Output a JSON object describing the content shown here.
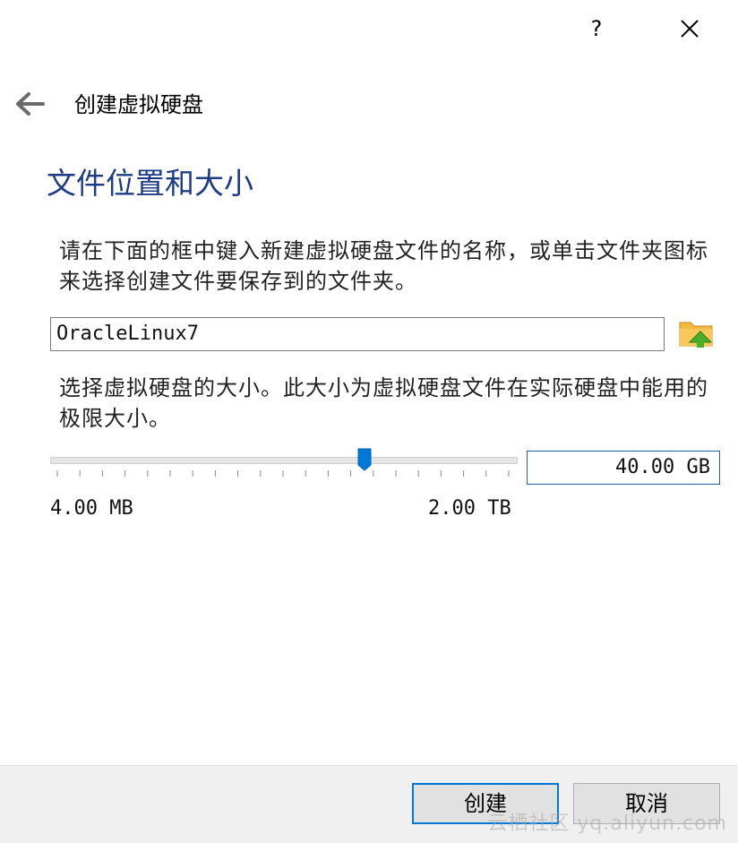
{
  "titlebar": {
    "help_label": "?",
    "help_icon": "question-icon",
    "close_icon": "close-icon"
  },
  "header": {
    "back_icon": "arrow-left-icon",
    "title": "创建虚拟硬盘"
  },
  "section": {
    "title": "文件位置和大小"
  },
  "location": {
    "description": "请在下面的框中键入新建虚拟硬盘文件的名称，或单击文件夹图标来选择创建文件要保存到的文件夹。",
    "file_name": "OracleLinux7",
    "folder_icon": "folder-icon"
  },
  "size": {
    "description": "选择虚拟硬盘的大小。此大小为虚拟硬盘文件在实际硬盘中能用的极限大小。",
    "value": "40.00 GB",
    "slider_fraction": 0.68,
    "min_label": "4.00 MB",
    "max_label": "2.00 TB"
  },
  "footer": {
    "create_label": "创建",
    "cancel_label": "取消"
  },
  "watermark": "云栖社区 yq.aliyun.com",
  "colors": {
    "title_blue": "#1e3c86",
    "accent": "#0078d7",
    "footer_bg": "#f0f0f0"
  }
}
